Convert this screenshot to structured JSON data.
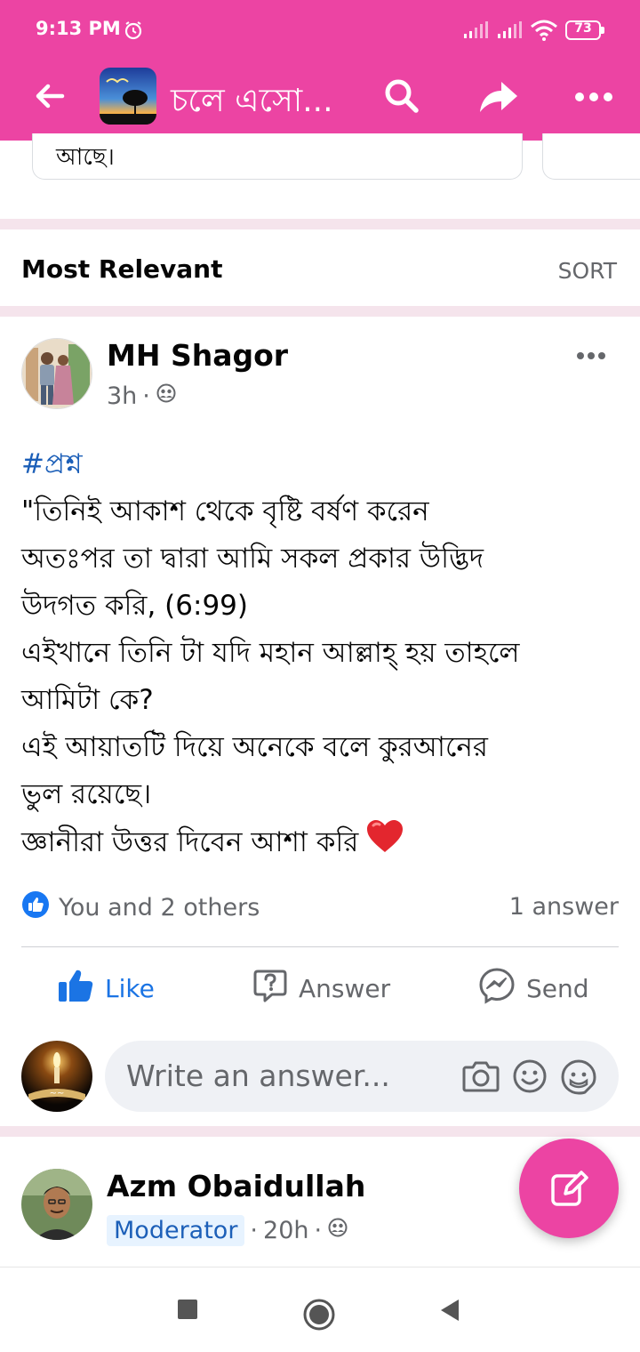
{
  "status_bar": {
    "time": "9:13 PM",
    "battery": "73",
    "icons": [
      "alarm-icon",
      "signal-icon",
      "signal-icon",
      "wifi-icon",
      "battery-icon"
    ]
  },
  "app_bar": {
    "title": "চলে এসো...",
    "icons": [
      "back-arrow-icon",
      "search-icon",
      "share-icon",
      "more-icon"
    ]
  },
  "previous_card": {
    "text": "আছে।"
  },
  "sort_row": {
    "label": "Most Relevant",
    "sort_label": "SORT"
  },
  "post": {
    "author": "MH Shagor",
    "time": "3h",
    "separator": "·",
    "privacy_icon": "group-privacy-icon",
    "hashtag": "#প্রশ্ন",
    "lines": [
      "\"তিনিই আকাশ থেকে বৃষ্টি বর্ষণ করেন",
      "অতঃপর তা দ্বারা আমি সকল প্রকার উদ্ভিদ",
      "উদগত করি, (6:99)",
      "এইখানে তিনি টা যদি মহান আল্লাহ্ হয় তাহলে",
      "আমিটা কে?",
      "এই আয়াতটি দিয়ে অনেকে বলে  কুরআনের",
      "ভুল রয়েছে।",
      "জ্ঞানীরা উত্তর দিবেন আশা করি"
    ],
    "reactions": "You and 2 others",
    "answers_count": "1 answer",
    "actions": {
      "like": "Like",
      "answer": "Answer",
      "send": "Send"
    },
    "accent_color": "#1b74e4"
  },
  "composer": {
    "placeholder": "Write an answer..."
  },
  "next_post": {
    "author": "Azm Obaidullah",
    "badge": "Moderator",
    "time": "20h",
    "separator": "·"
  },
  "theme": {
    "brand": "#ec44a3",
    "link": "#1c5fb8"
  }
}
